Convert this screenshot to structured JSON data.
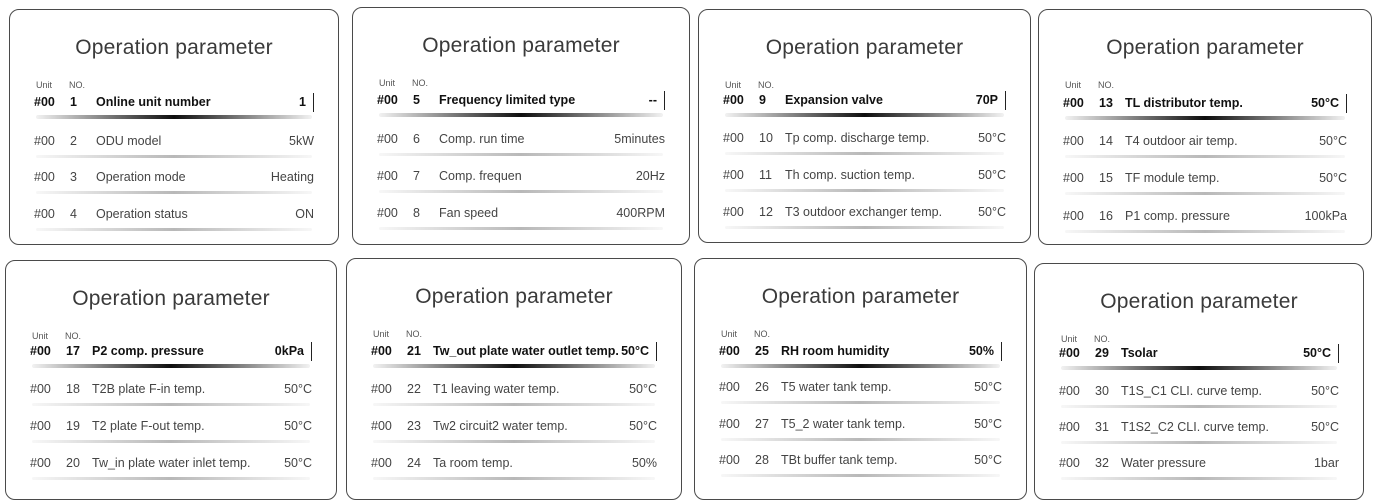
{
  "headers": {
    "unit": "Unit",
    "no": "NO."
  },
  "panels": [
    {
      "title": "Operation parameter",
      "rows": [
        {
          "unit": "#00",
          "no": "1",
          "name": "Online unit number",
          "value": "1"
        },
        {
          "unit": "#00",
          "no": "2",
          "name": "ODU model",
          "value": "5kW"
        },
        {
          "unit": "#00",
          "no": "3",
          "name": "Operation mode",
          "value": "Heating"
        },
        {
          "unit": "#00",
          "no": "4",
          "name": "Operation status",
          "value": "ON"
        }
      ]
    },
    {
      "title": "Operation parameter",
      "rows": [
        {
          "unit": "#00",
          "no": "5",
          "name": "Frequency limited type",
          "value": "--"
        },
        {
          "unit": "#00",
          "no": "6",
          "name": "Comp. run time",
          "value": "5minutes"
        },
        {
          "unit": "#00",
          "no": "7",
          "name": "Comp. frequen",
          "value": "20Hz"
        },
        {
          "unit": "#00",
          "no": "8",
          "name": "Fan speed",
          "value": "400RPM"
        }
      ]
    },
    {
      "title": "Operation parameter",
      "rows": [
        {
          "unit": "#00",
          "no": "9",
          "name": "Expansion valve",
          "value": "70P"
        },
        {
          "unit": "#00",
          "no": "10",
          "name": "Tp comp. discharge temp.",
          "value": "50°C"
        },
        {
          "unit": "#00",
          "no": "11",
          "name": "Th comp. suction temp.",
          "value": "50°C"
        },
        {
          "unit": "#00",
          "no": "12",
          "name": "T3 outdoor exchanger temp.",
          "value": "50°C"
        }
      ]
    },
    {
      "title": "Operation parameter",
      "rows": [
        {
          "unit": "#00",
          "no": "13",
          "name": "TL distributor temp.",
          "value": "50°C"
        },
        {
          "unit": "#00",
          "no": "14",
          "name": "T4 outdoor air temp.",
          "value": "50°C"
        },
        {
          "unit": "#00",
          "no": "15",
          "name": "TF module temp.",
          "value": "50°C"
        },
        {
          "unit": "#00",
          "no": "16",
          "name": "P1 comp. pressure",
          "value": "100kPa"
        }
      ]
    },
    {
      "title": "Operation parameter",
      "rows": [
        {
          "unit": "#00",
          "no": "17",
          "name": "P2 comp. pressure",
          "value": "0kPa"
        },
        {
          "unit": "#00",
          "no": "18",
          "name": "T2B plate F-in temp.",
          "value": "50°C"
        },
        {
          "unit": "#00",
          "no": "19",
          "name": "T2 plate F-out temp.",
          "value": "50°C"
        },
        {
          "unit": "#00",
          "no": "20",
          "name": "Tw_in plate water inlet temp.",
          "value": "50°C"
        }
      ]
    },
    {
      "title": "Operation parameter",
      "rows": [
        {
          "unit": "#00",
          "no": "21",
          "name": "Tw_out plate water outlet temp.",
          "value": "50°C"
        },
        {
          "unit": "#00",
          "no": "22",
          "name": "T1 leaving water temp.",
          "value": "50°C"
        },
        {
          "unit": "#00",
          "no": "23",
          "name": "Tw2 circuit2 water temp.",
          "value": "50°C"
        },
        {
          "unit": "#00",
          "no": "24",
          "name": "Ta room temp.",
          "value": "50%"
        }
      ]
    },
    {
      "title": "Operation parameter",
      "rows": [
        {
          "unit": "#00",
          "no": "25",
          "name": "RH room humidity",
          "value": "50%"
        },
        {
          "unit": "#00",
          "no": "26",
          "name": "T5 water tank temp.",
          "value": "50°C"
        },
        {
          "unit": "#00",
          "no": "27",
          "name": "T5_2 water tank temp.",
          "value": "50°C"
        },
        {
          "unit": "#00",
          "no": "28",
          "name": "TBt buffer tank temp.",
          "value": "50°C"
        }
      ]
    },
    {
      "title": "Operation parameter",
      "rows": [
        {
          "unit": "#00",
          "no": "29",
          "name": "Tsolar",
          "value": "50°C"
        },
        {
          "unit": "#00",
          "no": "30",
          "name": "T1S_C1 CLI. curve temp.",
          "value": "50°C"
        },
        {
          "unit": "#00",
          "no": "31",
          "name": "T1S2_C2 CLI. curve temp.",
          "value": "50°C"
        },
        {
          "unit": "#00",
          "no": "32",
          "name": "Water pressure",
          "value": "1bar"
        }
      ]
    }
  ]
}
